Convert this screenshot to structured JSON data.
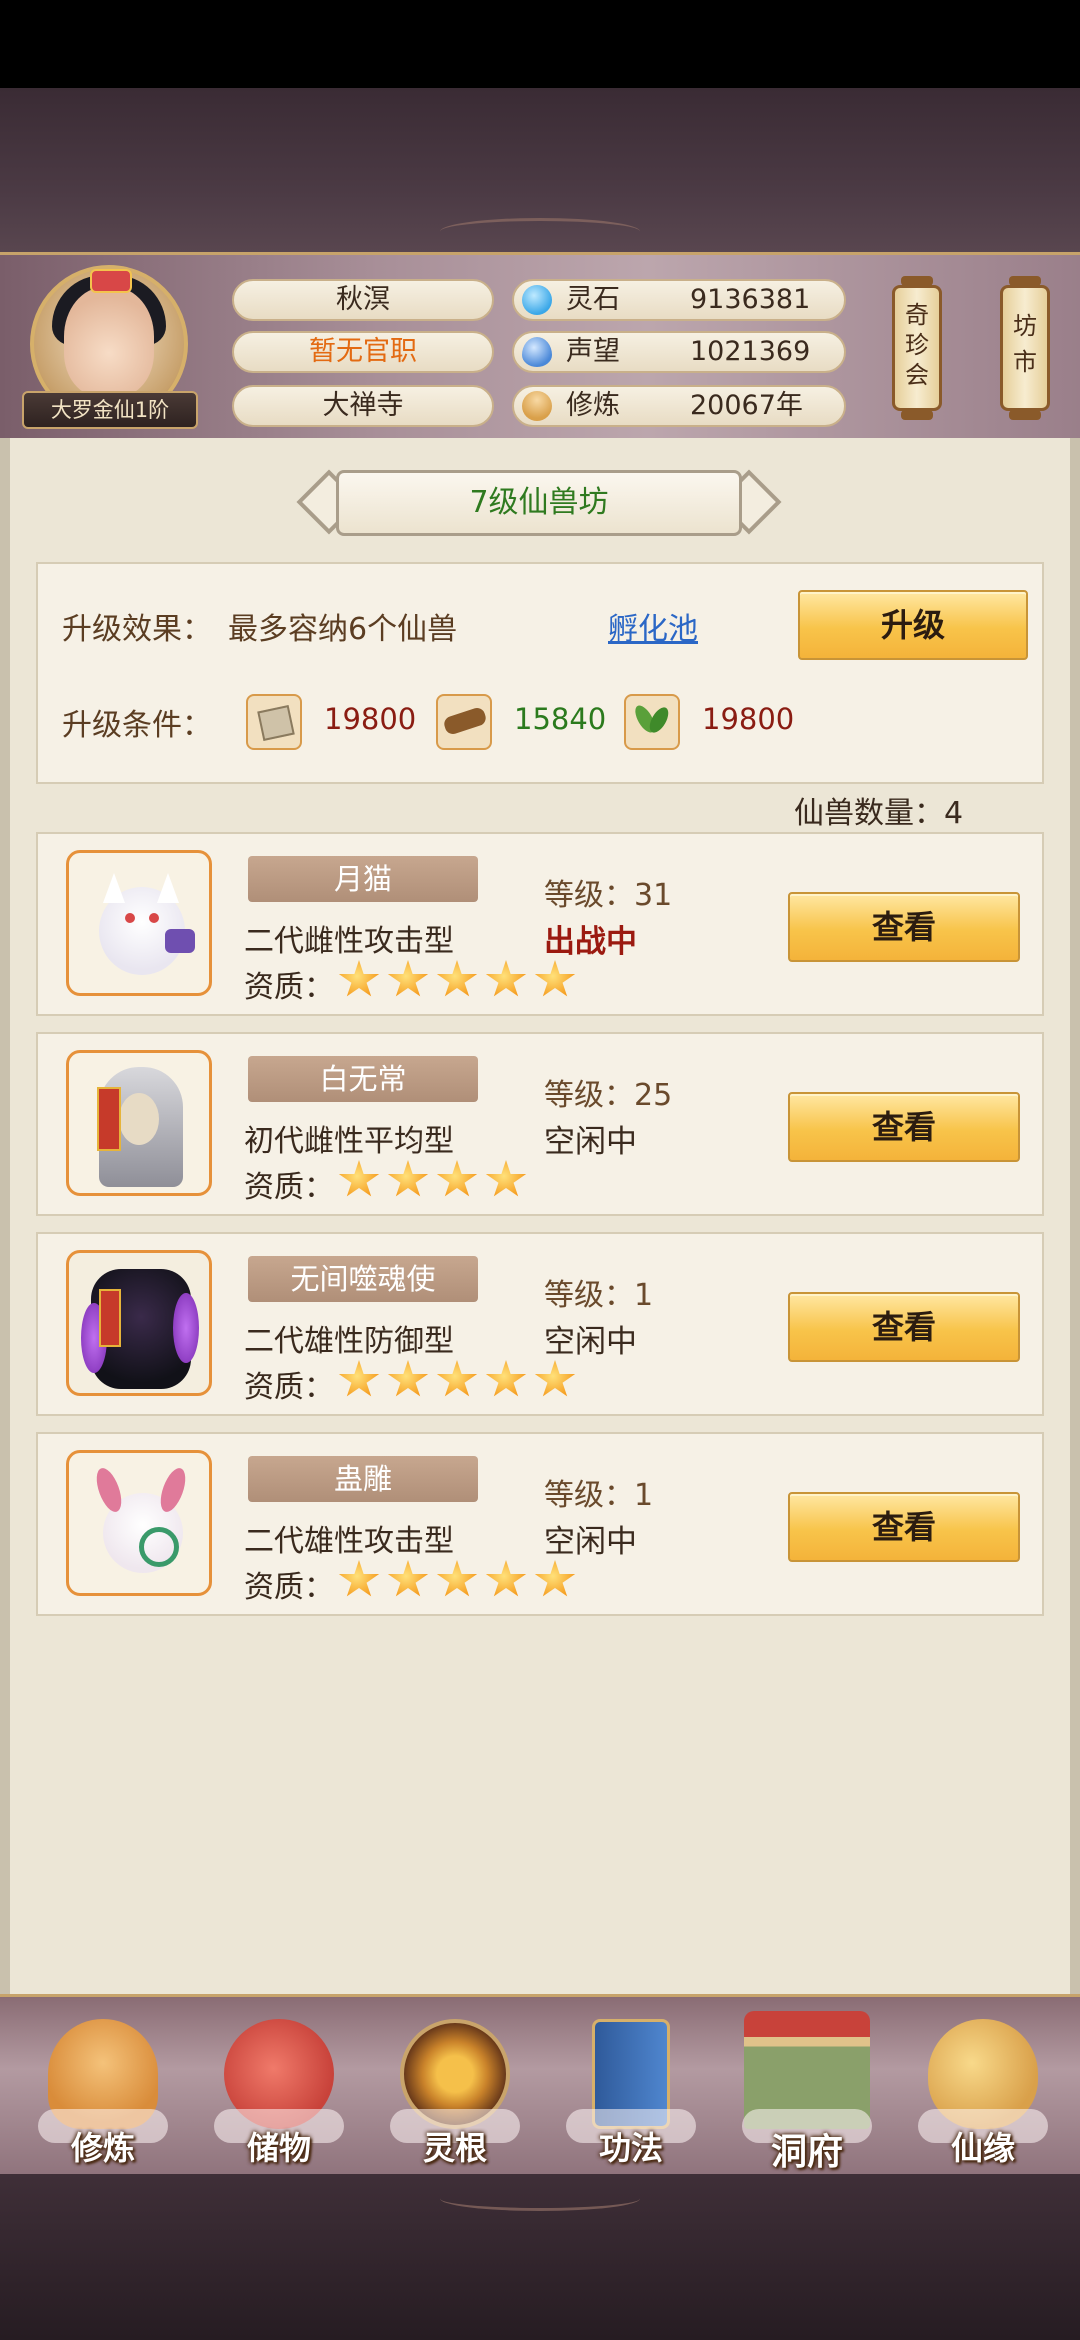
{
  "player": {
    "name": "秋溟",
    "title": "暂无官职",
    "sect": "大禅寺",
    "rank": "大罗金仙1阶"
  },
  "resources": [
    {
      "label": "灵石",
      "value": "9136381",
      "icon": "spirit-stone-icon",
      "color": "#3aa7e8"
    },
    {
      "label": "声望",
      "value": "1021369",
      "icon": "prestige-icon",
      "color": "#4a88d8"
    },
    {
      "label": "修炼",
      "value": "20067年",
      "icon": "meditation-icon",
      "color": "#d9a04a"
    }
  ],
  "side_buttons": [
    {
      "label": "奇珍会"
    },
    {
      "label": "坊市"
    }
  ],
  "building": {
    "title": "7级仙兽坊",
    "effect_label": "升级效果：",
    "effect_text": "最多容纳6个仙兽",
    "hatch_link": "孵化池",
    "upgrade_button": "升级",
    "condition_label": "升级条件：",
    "materials": [
      {
        "icon": "ore-material-icon",
        "amount": "19800",
        "color": "#8a1c12"
      },
      {
        "icon": "wood-material-icon",
        "amount": "15840",
        "color": "#2b7a1d"
      },
      {
        "icon": "herb-material-icon",
        "amount": "19800",
        "color": "#8a1c12"
      }
    ]
  },
  "beast_count": "仙兽数量：4",
  "beasts": [
    {
      "name": "月猫",
      "type": "二代雌性攻击型",
      "level": "等级：31",
      "status": "出战中",
      "active": true,
      "quality_label": "资质：",
      "stars": 5,
      "view": "查看",
      "icon": "white-cat-beast-icon"
    },
    {
      "name": "白无常",
      "type": "初代雌性平均型",
      "level": "等级：25",
      "status": "空闲中",
      "active": false,
      "quality_label": "资质：",
      "stars": 4,
      "view": "查看",
      "icon": "masked-ghost-beast-icon"
    },
    {
      "name": "无间噬魂使",
      "type": "二代雄性防御型",
      "level": "等级：1",
      "status": "空闲中",
      "active": false,
      "quality_label": "资质：",
      "stars": 5,
      "view": "查看",
      "icon": "dark-demon-beast-icon"
    },
    {
      "name": "蛊雕",
      "type": "二代雄性攻击型",
      "level": "等级：1",
      "status": "空闲中",
      "active": false,
      "quality_label": "资质：",
      "stars": 5,
      "view": "查看",
      "icon": "pink-eagle-beast-icon"
    }
  ],
  "nav": [
    {
      "label": "修炼",
      "icon": "cultivate-monk-icon",
      "color": "#d98c3a"
    },
    {
      "label": "储物",
      "icon": "storage-bag-icon",
      "color": "#c8423a"
    },
    {
      "label": "灵根",
      "icon": "spirit-root-icon",
      "color": "#c9822a"
    },
    {
      "label": "功法",
      "icon": "technique-book-icon",
      "color": "#3f6fb3"
    },
    {
      "label": "洞府",
      "icon": "cave-mansion-icon",
      "color": "#8aa06a"
    },
    {
      "label": "仙缘",
      "icon": "gourd-icon",
      "color": "#d9a04a"
    }
  ]
}
